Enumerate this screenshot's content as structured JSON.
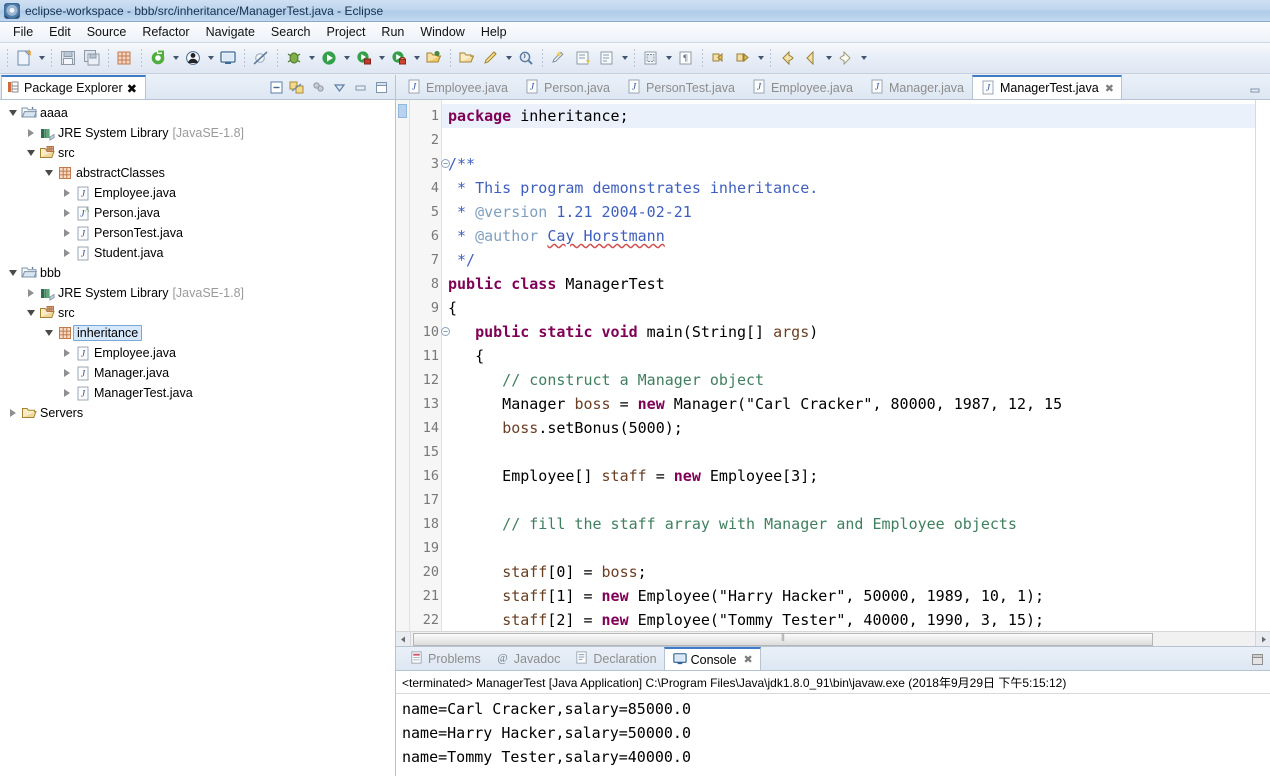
{
  "window": {
    "title": "eclipse-workspace - bbb/src/inheritance/ManagerTest.java - Eclipse",
    "app_icon": "eclipse-icon"
  },
  "menubar": {
    "items": [
      {
        "label": "File"
      },
      {
        "label": "Edit"
      },
      {
        "label": "Source"
      },
      {
        "label": "Refactor"
      },
      {
        "label": "Navigate"
      },
      {
        "label": "Search"
      },
      {
        "label": "Project"
      },
      {
        "label": "Run"
      },
      {
        "label": "Window"
      },
      {
        "label": "Help"
      }
    ]
  },
  "toolbar": {
    "buttons": [
      {
        "name": "new-wizard-icon",
        "title": "New"
      },
      {
        "name": "save-icon",
        "title": "Save"
      },
      {
        "name": "save-all-icon",
        "title": "Save All"
      },
      {
        "name": "new-java-package-icon",
        "title": "New Java Package"
      },
      {
        "name": "refresh-icon",
        "title": "Refresh"
      },
      {
        "name": "open-type-icon",
        "title": "Open Type"
      },
      {
        "name": "console-icon",
        "title": "Open Console"
      },
      {
        "name": "skip-breakpoints-icon",
        "title": "Skip All Breakpoints"
      },
      {
        "name": "debug-icon",
        "title": "Debug"
      },
      {
        "name": "run-icon",
        "title": "Run"
      },
      {
        "name": "run-external-tools-icon",
        "title": "External Tools"
      },
      {
        "name": "server-run-icon",
        "title": "Run Server"
      },
      {
        "name": "open-resource-icon",
        "title": "Open Resource"
      },
      {
        "name": "new-folder-icon",
        "title": "New Folder"
      },
      {
        "name": "edit-icon",
        "title": "Edit"
      },
      {
        "name": "search-java-icon",
        "title": "Search"
      },
      {
        "name": "quick-fix-icon",
        "title": "Quick Fix"
      },
      {
        "name": "next-annotation-icon",
        "title": "Next Annotation"
      },
      {
        "name": "toggle-mark-occurrences-icon",
        "title": "Toggle Mark Occurrences"
      },
      {
        "name": "toggle-block-selection-icon",
        "title": "Toggle Block Selection"
      },
      {
        "name": "show-whitespace-icon",
        "title": "Show Whitespace Characters"
      },
      {
        "name": "previous-edit-icon",
        "title": "Previous Edit Location"
      },
      {
        "name": "next-edit-icon",
        "title": "Next Edit Location"
      },
      {
        "name": "back-icon",
        "title": "Back"
      },
      {
        "name": "back-history-icon",
        "title": "Back History"
      },
      {
        "name": "forward-icon",
        "title": "Forward"
      }
    ]
  },
  "explorer": {
    "tab_label": "Package Explorer",
    "tab_icon": "package-explorer-icon",
    "tools": [
      {
        "name": "collapse-all-icon",
        "title": "Collapse All"
      },
      {
        "name": "link-with-editor-icon",
        "title": "Link with Editor"
      },
      {
        "name": "view-filter-icon",
        "title": "Filters"
      },
      {
        "name": "view-menu-icon",
        "title": "View Menu"
      },
      {
        "name": "minimize-icon",
        "title": "Minimize"
      },
      {
        "name": "maximize-icon",
        "title": "Maximize"
      }
    ],
    "tree": [
      {
        "label": "aaaa",
        "sub": "",
        "icon": "java-project-icon",
        "state": "open",
        "indent": 0
      },
      {
        "label": "JRE System Library",
        "sub": "[JavaSE-1.8]",
        "icon": "jre-library-icon",
        "state": "closed",
        "indent": 1
      },
      {
        "label": "src",
        "sub": "",
        "icon": "source-folder-icon",
        "state": "open",
        "indent": 1
      },
      {
        "label": "abstractClasses",
        "sub": "",
        "icon": "package-icon",
        "state": "open",
        "indent": 2
      },
      {
        "label": "Employee.java",
        "sub": "",
        "icon": "java-file-icon",
        "state": "closed",
        "indent": 3
      },
      {
        "label": "Person.java",
        "sub": "",
        "icon": "java-abstract-file-icon",
        "state": "closed",
        "indent": 3
      },
      {
        "label": "PersonTest.java",
        "sub": "",
        "icon": "java-file-icon",
        "state": "closed",
        "indent": 3
      },
      {
        "label": "Student.java",
        "sub": "",
        "icon": "java-file-icon",
        "state": "closed",
        "indent": 3
      },
      {
        "label": "bbb",
        "sub": "",
        "icon": "java-project-icon",
        "state": "open",
        "indent": 0
      },
      {
        "label": "JRE System Library",
        "sub": "[JavaSE-1.8]",
        "icon": "jre-library-icon",
        "state": "closed",
        "indent": 1
      },
      {
        "label": "src",
        "sub": "",
        "icon": "source-folder-icon",
        "state": "open",
        "indent": 1
      },
      {
        "label": "inheritance",
        "sub": "",
        "icon": "package-icon",
        "state": "open",
        "indent": 2,
        "selected": true
      },
      {
        "label": "Employee.java",
        "sub": "",
        "icon": "java-file-icon",
        "state": "closed",
        "indent": 3
      },
      {
        "label": "Manager.java",
        "sub": "",
        "icon": "java-file-icon",
        "state": "closed",
        "indent": 3
      },
      {
        "label": "ManagerTest.java",
        "sub": "",
        "icon": "java-file-icon",
        "state": "closed",
        "indent": 3
      },
      {
        "label": "Servers",
        "sub": "",
        "icon": "folder-icon",
        "state": "closed",
        "indent": 0
      }
    ]
  },
  "editor": {
    "tabs": [
      {
        "label": "Employee.java",
        "active": false
      },
      {
        "label": "Person.java",
        "active": false
      },
      {
        "label": "PersonTest.java",
        "active": false
      },
      {
        "label": "Employee.java",
        "active": false
      },
      {
        "label": "Manager.java",
        "active": false
      },
      {
        "label": "ManagerTest.java",
        "active": true,
        "close": "✖"
      }
    ],
    "line_numbers": [
      "1",
      "2",
      "3",
      "4",
      "5",
      "6",
      "7",
      "8",
      "9",
      "10",
      "11",
      "12",
      "13",
      "14",
      "15",
      "16",
      "17",
      "18",
      "19",
      "20",
      "21",
      "22"
    ],
    "fold_lines": [
      "3",
      "10"
    ],
    "code_lines": [
      "package inheritance;",
      "",
      "/**",
      " * This program demonstrates inheritance.",
      " * @version 1.21 2004-02-21",
      " * @author Cay Horstmann",
      " */",
      "public class ManagerTest",
      "{",
      "   public static void main(String[] args)",
      "   {",
      "      // construct a Manager object",
      "      Manager boss = new Manager(\"Carl Cracker\", 80000, 1987, 12, 15",
      "      boss.setBonus(5000);",
      "",
      "      Employee[] staff = new Employee[3];",
      "",
      "      // fill the staff array with Manager and Employee objects",
      "",
      "      staff[0] = boss;",
      "      staff[1] = new Employee(\"Harry Hacker\", 50000, 1989, 10, 1);",
      "      staff[2] = new Employee(\"Tommy Tester\", 40000, 1990, 3, 15);"
    ]
  },
  "console": {
    "tabs": [
      {
        "label": "Problems",
        "icon": "problems-icon",
        "active": false
      },
      {
        "label": "Javadoc",
        "icon": "javadoc-icon",
        "active": false
      },
      {
        "label": "Declaration",
        "icon": "declaration-icon",
        "active": false
      },
      {
        "label": "Console",
        "icon": "console-icon",
        "active": true,
        "close": "✖"
      }
    ],
    "tools": [
      {
        "name": "console-maximize-icon",
        "title": "Maximize"
      }
    ],
    "launch_info": "<terminated> ManagerTest [Java Application] C:\\Program Files\\Java\\jdk1.8.0_91\\bin\\javaw.exe (2018年9月29日 下午5:15:12)",
    "output_lines": [
      "name=Carl Cracker,salary=85000.0",
      "name=Harry Hacker,salary=50000.0",
      "name=Tommy Tester,salary=40000.0"
    ]
  },
  "colors": {
    "accent": "#3e7bc8",
    "keyword": "#7f0055",
    "string": "#2a00ff",
    "comment": "#3f7f5f",
    "javadoc": "#3f5fbf",
    "javadoc_tag": "#7f9fbf",
    "local_var": "#6a3e23",
    "selection": "#d6e8fb"
  }
}
